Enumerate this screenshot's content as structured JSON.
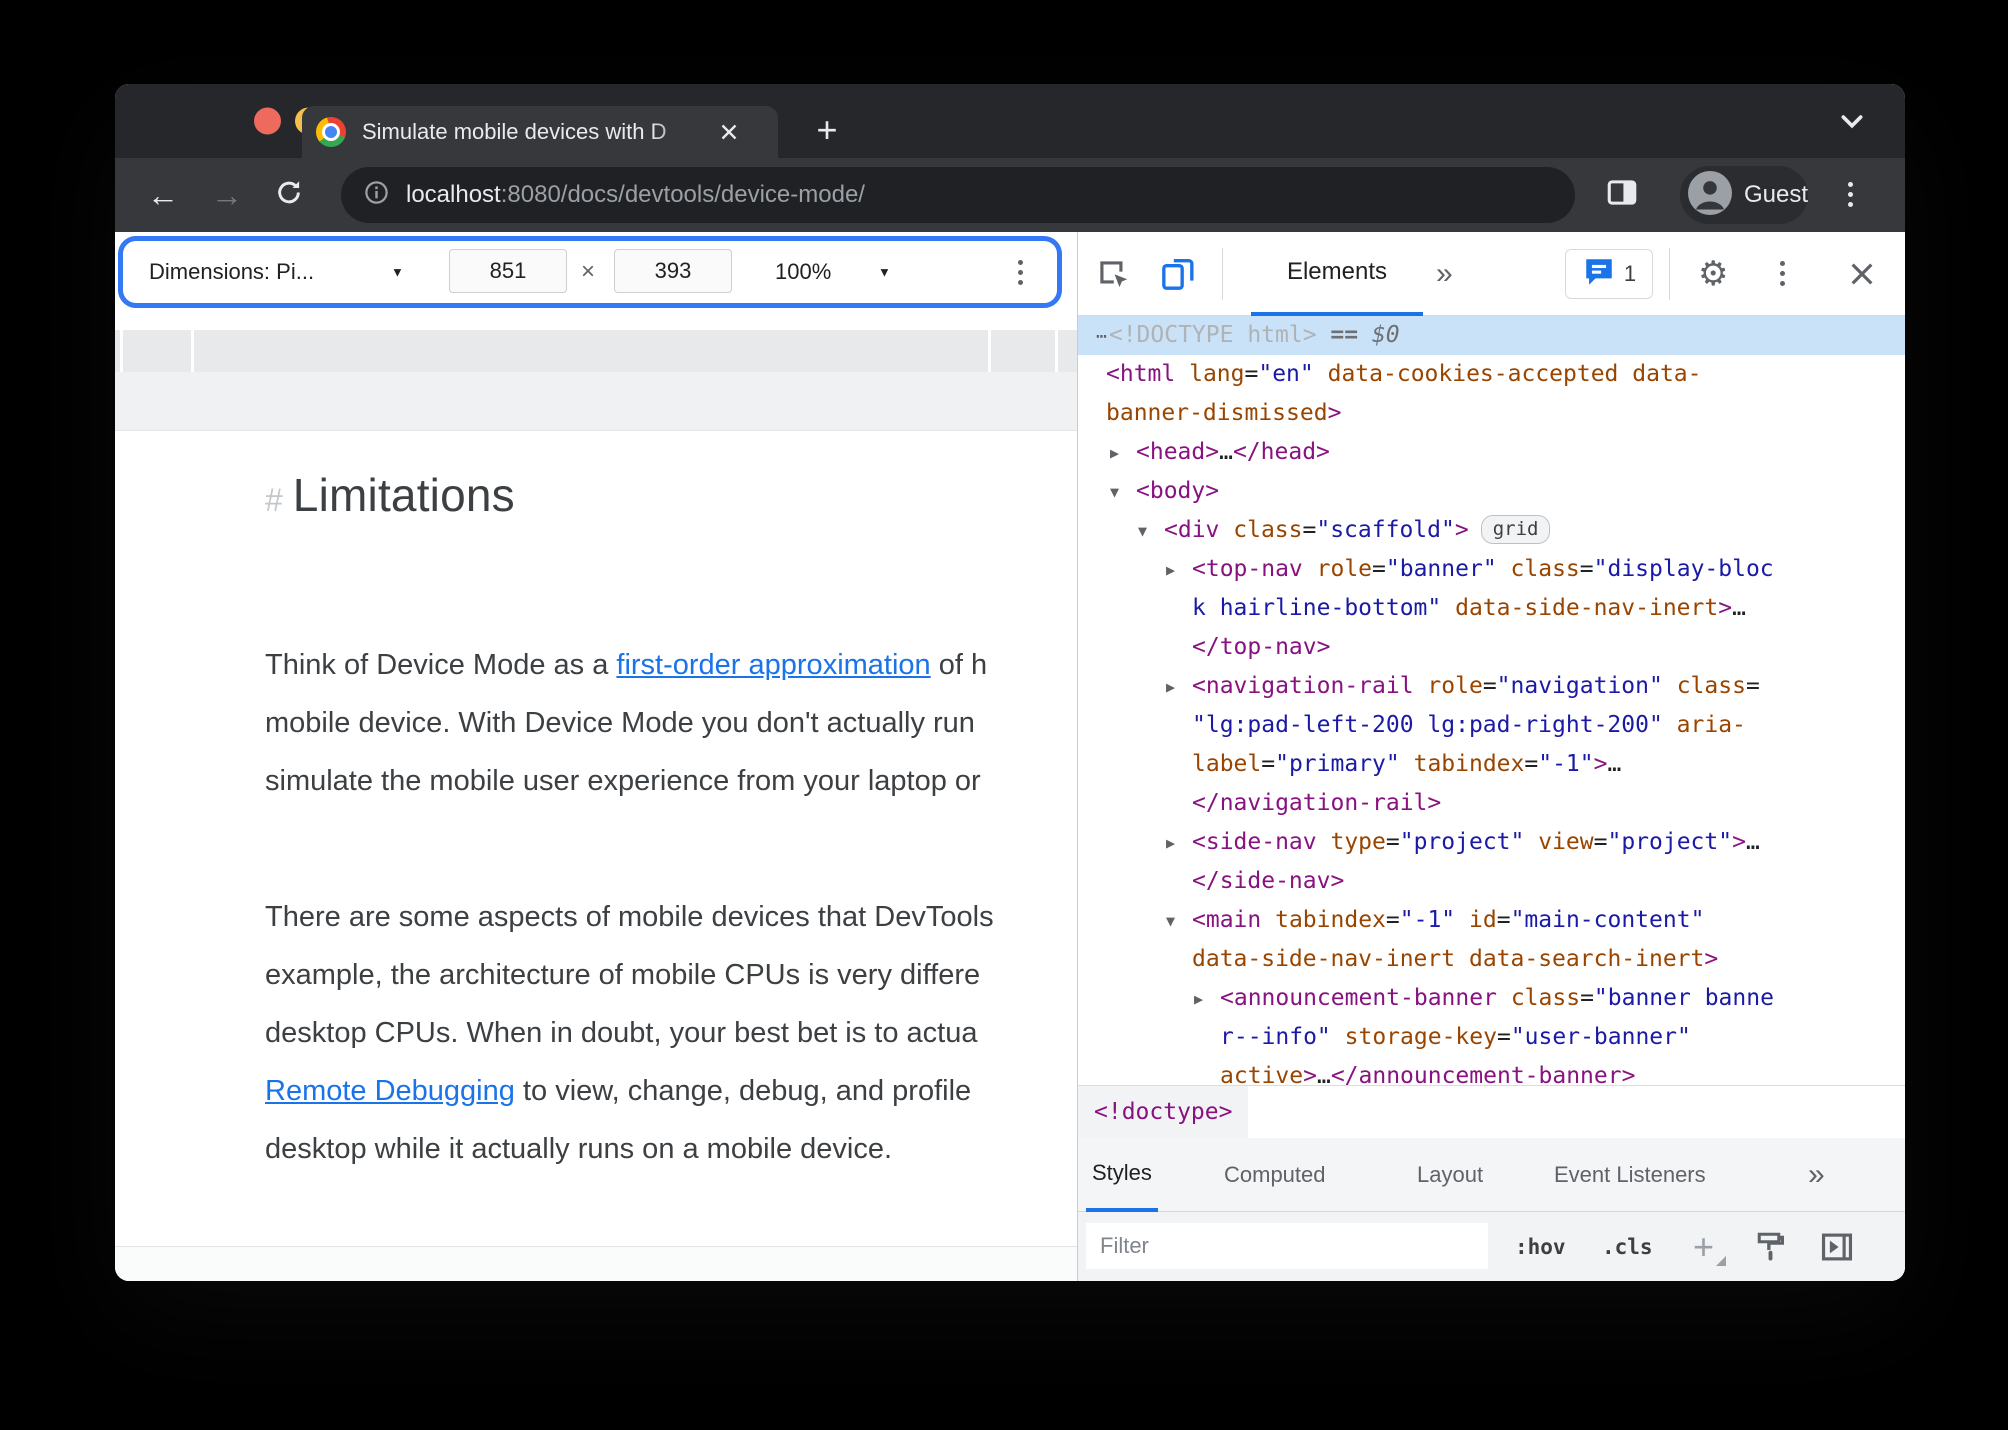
{
  "browser": {
    "tab": {
      "title": "Simulate mobile devices with D",
      "new_tab_label": "+"
    },
    "address_bar": {
      "host": "localhost",
      "path": ":8080/docs/devtools/device-mode/"
    },
    "profile_label": "Guest"
  },
  "device_toolbar": {
    "dimensions_label": "Dimensions: Pi...",
    "width_value": "851",
    "separator": "×",
    "height_value": "393",
    "zoom_value": "100%"
  },
  "devtools": {
    "toolbar": {
      "elements_tab": "Elements",
      "more_tabs": "»",
      "console_badge_count": "1"
    },
    "dom": {
      "lines": [
        {
          "sel": true,
          "dots": true,
          "ind": 18,
          "tok": [
            {
              "c": "doctype",
              "t": "<!DOCTYPE html>"
            },
            {
              "c": "dim",
              "t": " == "
            },
            {
              "c": "dollar",
              "t": "$0"
            }
          ]
        },
        {
          "ind": 28,
          "tok": [
            {
              "c": "tag",
              "t": "<html"
            },
            {
              "c": "def",
              "t": " "
            },
            {
              "c": "attr",
              "t": "lang"
            },
            {
              "c": "def",
              "t": "="
            },
            {
              "c": "val",
              "t": "\"en\""
            },
            {
              "c": "def",
              "t": " "
            },
            {
              "c": "attr",
              "t": "data-cookies-accepted"
            },
            {
              "c": "def",
              "t": " "
            },
            {
              "c": "attr",
              "t": "data-"
            }
          ]
        },
        {
          "ind": 28,
          "tok": [
            {
              "c": "attr",
              "t": "banner-dismissed"
            },
            {
              "c": "tag",
              "t": ">"
            }
          ]
        },
        {
          "ind": 58,
          "arrow": "r",
          "tok": [
            {
              "c": "tag",
              "t": "<head>"
            },
            {
              "c": "def",
              "t": "…"
            },
            {
              "c": "tag",
              "t": "</head>"
            }
          ]
        },
        {
          "ind": 58,
          "arrow": "d",
          "tok": [
            {
              "c": "tag",
              "t": "<body>"
            }
          ]
        },
        {
          "ind": 86,
          "arrow": "d",
          "tok": [
            {
              "c": "tag",
              "t": "<div"
            },
            {
              "c": "def",
              "t": " "
            },
            {
              "c": "attr",
              "t": "class"
            },
            {
              "c": "def",
              "t": "="
            },
            {
              "c": "val",
              "t": "\"scaffold\""
            },
            {
              "c": "tag",
              "t": ">"
            },
            {
              "c": "badge",
              "t": "grid"
            }
          ]
        },
        {
          "ind": 114,
          "arrow": "r",
          "tok": [
            {
              "c": "tag",
              "t": "<top-nav"
            },
            {
              "c": "def",
              "t": " "
            },
            {
              "c": "attr",
              "t": "role"
            },
            {
              "c": "def",
              "t": "="
            },
            {
              "c": "val",
              "t": "\"banner\""
            },
            {
              "c": "def",
              "t": " "
            },
            {
              "c": "attr",
              "t": "class"
            },
            {
              "c": "def",
              "t": "="
            },
            {
              "c": "val",
              "t": "\"display-bloc"
            }
          ]
        },
        {
          "ind": 114,
          "tok": [
            {
              "c": "val",
              "t": "k hairline-bottom\""
            },
            {
              "c": "def",
              "t": " "
            },
            {
              "c": "attr",
              "t": "data-side-nav-inert"
            },
            {
              "c": "tag",
              "t": ">"
            },
            {
              "c": "def",
              "t": "…"
            }
          ]
        },
        {
          "ind": 114,
          "tok": [
            {
              "c": "tag",
              "t": "</top-nav>"
            }
          ]
        },
        {
          "ind": 114,
          "arrow": "r",
          "tok": [
            {
              "c": "tag",
              "t": "<navigation-rail"
            },
            {
              "c": "def",
              "t": " "
            },
            {
              "c": "attr",
              "t": "role"
            },
            {
              "c": "def",
              "t": "="
            },
            {
              "c": "val",
              "t": "\"navigation\""
            },
            {
              "c": "def",
              "t": " "
            },
            {
              "c": "attr",
              "t": "class"
            },
            {
              "c": "def",
              "t": "="
            }
          ]
        },
        {
          "ind": 114,
          "tok": [
            {
              "c": "val",
              "t": "\"lg:pad-left-200 lg:pad-right-200\""
            },
            {
              "c": "def",
              "t": " "
            },
            {
              "c": "attr",
              "t": "aria-"
            }
          ]
        },
        {
          "ind": 114,
          "tok": [
            {
              "c": "attr",
              "t": "label"
            },
            {
              "c": "def",
              "t": "="
            },
            {
              "c": "val",
              "t": "\"primary\""
            },
            {
              "c": "def",
              "t": " "
            },
            {
              "c": "attr",
              "t": "tabindex"
            },
            {
              "c": "def",
              "t": "="
            },
            {
              "c": "val",
              "t": "\"-1\""
            },
            {
              "c": "tag",
              "t": ">"
            },
            {
              "c": "def",
              "t": "…"
            }
          ]
        },
        {
          "ind": 114,
          "tok": [
            {
              "c": "tag",
              "t": "</navigation-rail>"
            }
          ]
        },
        {
          "ind": 114,
          "arrow": "r",
          "tok": [
            {
              "c": "tag",
              "t": "<side-nav"
            },
            {
              "c": "def",
              "t": " "
            },
            {
              "c": "attr",
              "t": "type"
            },
            {
              "c": "def",
              "t": "="
            },
            {
              "c": "val",
              "t": "\"project\""
            },
            {
              "c": "def",
              "t": " "
            },
            {
              "c": "attr",
              "t": "view"
            },
            {
              "c": "def",
              "t": "="
            },
            {
              "c": "val",
              "t": "\"project\""
            },
            {
              "c": "tag",
              "t": ">"
            },
            {
              "c": "def",
              "t": "…"
            }
          ]
        },
        {
          "ind": 114,
          "tok": [
            {
              "c": "tag",
              "t": "</side-nav>"
            }
          ]
        },
        {
          "ind": 114,
          "arrow": "d",
          "tok": [
            {
              "c": "tag",
              "t": "<main"
            },
            {
              "c": "def",
              "t": " "
            },
            {
              "c": "attr",
              "t": "tabindex"
            },
            {
              "c": "def",
              "t": "="
            },
            {
              "c": "val",
              "t": "\"-1\""
            },
            {
              "c": "def",
              "t": " "
            },
            {
              "c": "attr",
              "t": "id"
            },
            {
              "c": "def",
              "t": "="
            },
            {
              "c": "val",
              "t": "\"main-content\""
            }
          ]
        },
        {
          "ind": 114,
          "tok": [
            {
              "c": "attr",
              "t": "data-side-nav-inert"
            },
            {
              "c": "def",
              "t": " "
            },
            {
              "c": "attr",
              "t": "data-search-inert"
            },
            {
              "c": "tag",
              "t": ">"
            }
          ]
        },
        {
          "ind": 142,
          "arrow": "r",
          "tok": [
            {
              "c": "tag",
              "t": "<announcement-banner"
            },
            {
              "c": "def",
              "t": " "
            },
            {
              "c": "attr",
              "t": "class"
            },
            {
              "c": "def",
              "t": "="
            },
            {
              "c": "val",
              "t": "\"banner banne"
            }
          ]
        },
        {
          "ind": 142,
          "tok": [
            {
              "c": "val",
              "t": "r--info\""
            },
            {
              "c": "def",
              "t": " "
            },
            {
              "c": "attr",
              "t": "storage-key"
            },
            {
              "c": "def",
              "t": "="
            },
            {
              "c": "val",
              "t": "\"user-banner\""
            }
          ]
        },
        {
          "ind": 142,
          "tok": [
            {
              "c": "attr",
              "t": "active"
            },
            {
              "c": "tag",
              "t": ">"
            },
            {
              "c": "def",
              "t": "…"
            },
            {
              "c": "tag",
              "t": "</announcement-banner>"
            }
          ]
        }
      ]
    },
    "breadcrumb": "<!doctype>",
    "styles_pane": {
      "tabs": [
        "Styles",
        "Computed",
        "Layout",
        "Event Listeners"
      ],
      "more_tabs": "»",
      "filter_placeholder": "Filter",
      "hov_label": ":hov",
      "cls_label": ".cls",
      "plus_label": "+"
    }
  },
  "page": {
    "heading_hash": "#",
    "heading": "Limitations",
    "paragraphs": [
      {
        "lines": [
          [
            {
              "t": "Think of Device Mode as a "
            },
            {
              "t": "first-order approximation",
              "link": true
            },
            {
              "t": " of h"
            }
          ],
          [
            {
              "t": "mobile device. With Device Mode you don't actually run"
            }
          ],
          [
            {
              "t": "simulate the mobile user experience from your laptop or"
            }
          ]
        ]
      },
      {
        "lines": [
          [
            {
              "t": "There are some aspects of mobile devices that DevTools"
            }
          ],
          [
            {
              "t": "example, the architecture of mobile CPUs is very differe"
            }
          ],
          [
            {
              "t": "desktop CPUs. When in doubt, your best bet is to actua"
            }
          ],
          [
            {
              "t": "Remote Debugging",
              "link": true
            },
            {
              "t": " to view, change, debug, and profile"
            }
          ],
          [
            {
              "t": "desktop while it actually runs on a mobile device."
            }
          ]
        ]
      }
    ]
  },
  "icons": {
    "caret_down": "▼",
    "gear": "⚙",
    "more_chevrons": "»",
    "row_dots": "⋯"
  },
  "colors": {
    "accent_blue": "#1a73e8",
    "highlight_border": "#3478f5",
    "dom_tag": "#881280",
    "dom_attr": "#994500",
    "dom_value": "#1a1aa6",
    "dom_selection_bg": "#c9e2f7",
    "chrome_dark": "#26272b",
    "chrome_toolbar": "#37383c"
  }
}
